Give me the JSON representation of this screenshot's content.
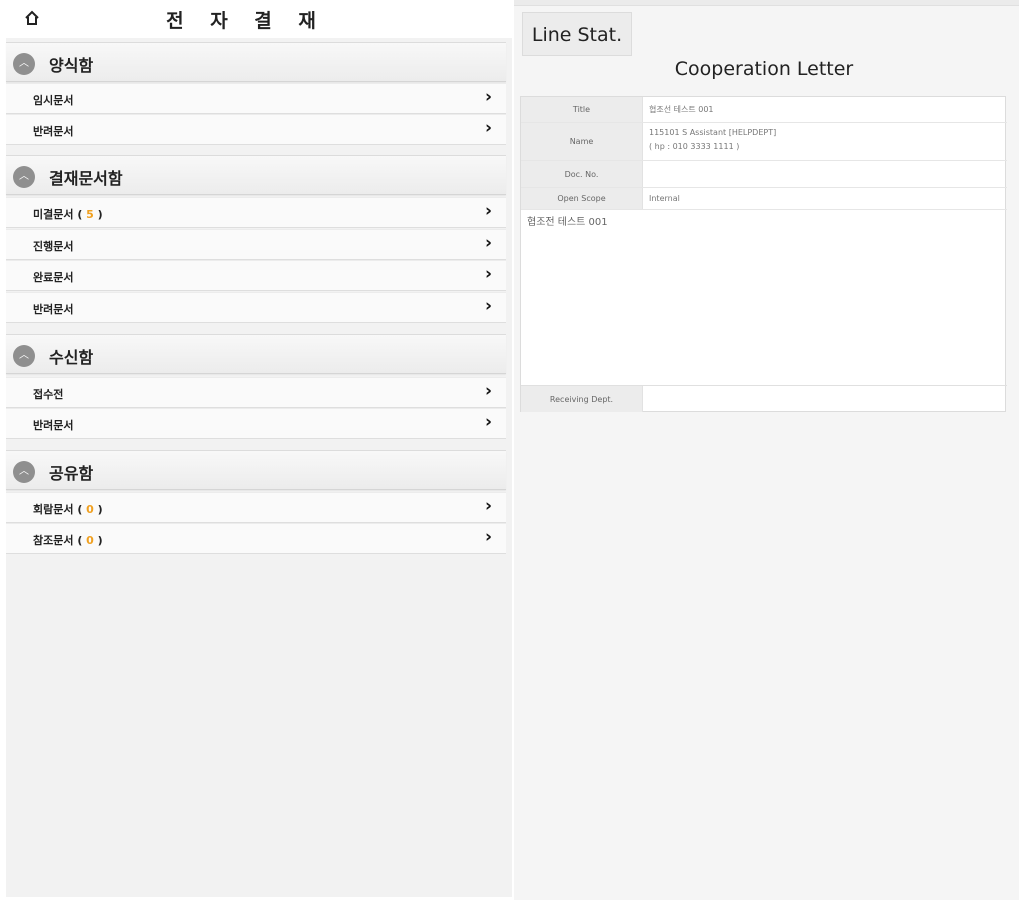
{
  "left": {
    "title": "전 자 결 재",
    "sections": [
      {
        "label": "양식함",
        "items": [
          {
            "label": "임시문서",
            "count": ""
          },
          {
            "label": "반려문서",
            "count": ""
          }
        ]
      },
      {
        "label": "결재문서함",
        "items": [
          {
            "label": "미결문서",
            "count": "5"
          },
          {
            "label": "진행문서",
            "count": ""
          },
          {
            "label": "완료문서",
            "count": ""
          },
          {
            "label": "반려문서",
            "count": ""
          }
        ]
      },
      {
        "label": "수신함",
        "items": [
          {
            "label": "접수전",
            "count": ""
          },
          {
            "label": "반려문서",
            "count": ""
          }
        ]
      },
      {
        "label": "공유함",
        "items": [
          {
            "label": "회람문서",
            "count": "0"
          },
          {
            "label": "참조문서",
            "count": "0"
          }
        ]
      }
    ]
  },
  "right": {
    "line_button": "Line Stat.",
    "doc_title": "Cooperation Letter",
    "fields": {
      "title_label": "Title",
      "title_value": "협조선 테스트 001",
      "name_label": "Name",
      "name_value_1": "115101 S Assistant [HELPDEPT]",
      "name_value_2": "( hp : 010 3333 1111 )",
      "doc_no_label": "Doc. No.",
      "doc_no_value": "",
      "scope_label": "Open Scope",
      "scope_value": "Internal",
      "receiving_label": "Receiving Dept.",
      "receiving_value": ""
    },
    "content": "협조전 테스트 001"
  },
  "colors": {
    "count_accent": "#f0a020",
    "section_icon": "#8f8f8f"
  }
}
